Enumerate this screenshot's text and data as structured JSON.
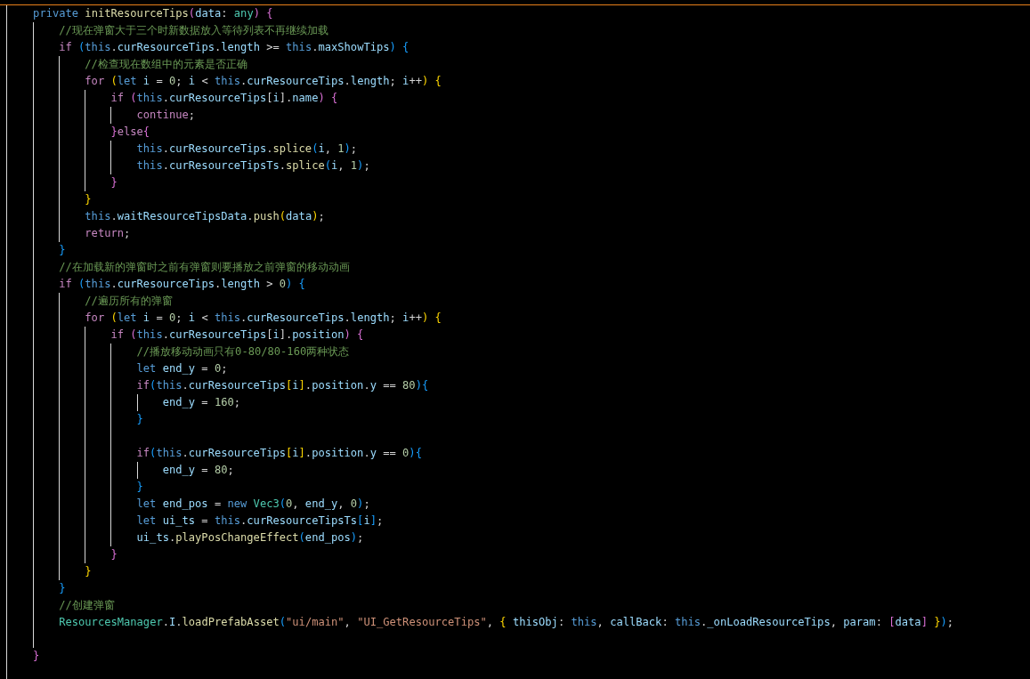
{
  "editor": {
    "lines": [
      {
        "kind": "code",
        "tokens": [
          {
            "kind": "kw",
            "text": "    private"
          },
          {
            "kind": "fn",
            "text": " initResourceTips"
          },
          {
            "kind": "b2",
            "text": "("
          },
          {
            "kind": "var",
            "text": "data"
          },
          {
            "kind": "pun",
            "text": ": "
          },
          {
            "kind": "type",
            "text": "any"
          },
          {
            "kind": "b2",
            "text": ")"
          },
          {
            "kind": "b2",
            "text": " {"
          }
        ]
      },
      {
        "kind": "code",
        "tokens": [
          {
            "kind": "cmt",
            "text": "        //现在弹窗大于三个时新数据放入等待列表不再继续加载"
          }
        ]
      },
      {
        "kind": "code",
        "tokens": [
          {
            "kind": "ctl",
            "text": "        if"
          },
          {
            "kind": "b3",
            "text": " ("
          },
          {
            "kind": "kw",
            "text": "this"
          },
          {
            "kind": "pun",
            "text": "."
          },
          {
            "kind": "var",
            "text": "curResourceTips"
          },
          {
            "kind": "pun",
            "text": "."
          },
          {
            "kind": "var",
            "text": "length"
          },
          {
            "kind": "pun",
            "text": " >= "
          },
          {
            "kind": "kw",
            "text": "this"
          },
          {
            "kind": "pun",
            "text": "."
          },
          {
            "kind": "var",
            "text": "maxShowTips"
          },
          {
            "kind": "b3",
            "text": ")"
          },
          {
            "kind": "b3",
            "text": " {"
          }
        ]
      },
      {
        "kind": "code",
        "tokens": [
          {
            "kind": "cmt",
            "text": "            //检查现在数组中的元素是否正确"
          }
        ]
      },
      {
        "kind": "code",
        "tokens": [
          {
            "kind": "ctl",
            "text": "            for"
          },
          {
            "kind": "b1",
            "text": " ("
          },
          {
            "kind": "kw",
            "text": "let"
          },
          {
            "kind": "var",
            "text": " i"
          },
          {
            "kind": "pun",
            "text": " = "
          },
          {
            "kind": "num",
            "text": "0"
          },
          {
            "kind": "pun",
            "text": "; "
          },
          {
            "kind": "var",
            "text": "i"
          },
          {
            "kind": "pun",
            "text": " < "
          },
          {
            "kind": "kw",
            "text": "this"
          },
          {
            "kind": "pun",
            "text": "."
          },
          {
            "kind": "var",
            "text": "curResourceTips"
          },
          {
            "kind": "pun",
            "text": "."
          },
          {
            "kind": "var",
            "text": "length"
          },
          {
            "kind": "pun",
            "text": "; "
          },
          {
            "kind": "var",
            "text": "i"
          },
          {
            "kind": "pun",
            "text": "++"
          },
          {
            "kind": "b1",
            "text": ")"
          },
          {
            "kind": "b1",
            "text": " {"
          }
        ]
      },
      {
        "kind": "code",
        "tokens": [
          {
            "kind": "ctl",
            "text": "                if"
          },
          {
            "kind": "b2",
            "text": " ("
          },
          {
            "kind": "kw",
            "text": "this"
          },
          {
            "kind": "pun",
            "text": "."
          },
          {
            "kind": "var",
            "text": "curResourceTips"
          },
          {
            "kind": "pun",
            "text": "["
          },
          {
            "kind": "var",
            "text": "i"
          },
          {
            "kind": "pun",
            "text": "]."
          },
          {
            "kind": "var",
            "text": "name"
          },
          {
            "kind": "b2",
            "text": ")"
          },
          {
            "kind": "b2",
            "text": " {"
          }
        ]
      },
      {
        "kind": "code",
        "tokens": [
          {
            "kind": "ctl",
            "text": "                    continue"
          },
          {
            "kind": "pun",
            "text": ";"
          }
        ]
      },
      {
        "kind": "code",
        "tokens": [
          {
            "kind": "b2",
            "text": "                }"
          },
          {
            "kind": "ctl",
            "text": "else"
          },
          {
            "kind": "b2",
            "text": "{"
          }
        ]
      },
      {
        "kind": "code",
        "tokens": [
          {
            "kind": "kw",
            "text": "                    this"
          },
          {
            "kind": "pun",
            "text": "."
          },
          {
            "kind": "var",
            "text": "curResourceTips"
          },
          {
            "kind": "pun",
            "text": "."
          },
          {
            "kind": "fn",
            "text": "splice"
          },
          {
            "kind": "b3",
            "text": "("
          },
          {
            "kind": "var",
            "text": "i"
          },
          {
            "kind": "pun",
            "text": ", "
          },
          {
            "kind": "num",
            "text": "1"
          },
          {
            "kind": "b3",
            "text": ")"
          },
          {
            "kind": "pun",
            "text": ";"
          }
        ]
      },
      {
        "kind": "code",
        "tokens": [
          {
            "kind": "kw",
            "text": "                    this"
          },
          {
            "kind": "pun",
            "text": "."
          },
          {
            "kind": "var",
            "text": "curResourceTipsTs"
          },
          {
            "kind": "pun",
            "text": "."
          },
          {
            "kind": "fn",
            "text": "splice"
          },
          {
            "kind": "b3",
            "text": "("
          },
          {
            "kind": "var",
            "text": "i"
          },
          {
            "kind": "pun",
            "text": ", "
          },
          {
            "kind": "num",
            "text": "1"
          },
          {
            "kind": "b3",
            "text": ")"
          },
          {
            "kind": "pun",
            "text": ";"
          }
        ]
      },
      {
        "kind": "code",
        "tokens": [
          {
            "kind": "b2",
            "text": "                }"
          }
        ]
      },
      {
        "kind": "code",
        "tokens": [
          {
            "kind": "b1",
            "text": "            }"
          }
        ]
      },
      {
        "kind": "code",
        "tokens": [
          {
            "kind": "kw",
            "text": "            this"
          },
          {
            "kind": "pun",
            "text": "."
          },
          {
            "kind": "var",
            "text": "waitResourceTipsData"
          },
          {
            "kind": "pun",
            "text": "."
          },
          {
            "kind": "fn",
            "text": "push"
          },
          {
            "kind": "b1",
            "text": "("
          },
          {
            "kind": "var",
            "text": "data"
          },
          {
            "kind": "b1",
            "text": ")"
          },
          {
            "kind": "pun",
            "text": ";"
          }
        ]
      },
      {
        "kind": "code",
        "tokens": [
          {
            "kind": "ctl",
            "text": "            return"
          },
          {
            "kind": "pun",
            "text": ";"
          }
        ]
      },
      {
        "kind": "code",
        "tokens": [
          {
            "kind": "b3",
            "text": "        }"
          }
        ]
      },
      {
        "kind": "code",
        "tokens": [
          {
            "kind": "cmt",
            "text": "        //在加载新的弹窗时之前有弹窗则要播放之前弹窗的移动动画"
          }
        ]
      },
      {
        "kind": "code",
        "tokens": [
          {
            "kind": "ctl",
            "text": "        if"
          },
          {
            "kind": "b3",
            "text": " ("
          },
          {
            "kind": "kw",
            "text": "this"
          },
          {
            "kind": "pun",
            "text": "."
          },
          {
            "kind": "var",
            "text": "curResourceTips"
          },
          {
            "kind": "pun",
            "text": "."
          },
          {
            "kind": "var",
            "text": "length"
          },
          {
            "kind": "pun",
            "text": " > "
          },
          {
            "kind": "num",
            "text": "0"
          },
          {
            "kind": "b3",
            "text": ")"
          },
          {
            "kind": "b3",
            "text": " {"
          }
        ]
      },
      {
        "kind": "code",
        "tokens": [
          {
            "kind": "cmt",
            "text": "            //遍历所有的弹窗"
          }
        ]
      },
      {
        "kind": "code",
        "tokens": [
          {
            "kind": "ctl",
            "text": "            for"
          },
          {
            "kind": "b1",
            "text": " ("
          },
          {
            "kind": "kw",
            "text": "let"
          },
          {
            "kind": "var",
            "text": " i"
          },
          {
            "kind": "pun",
            "text": " = "
          },
          {
            "kind": "num",
            "text": "0"
          },
          {
            "kind": "pun",
            "text": "; "
          },
          {
            "kind": "var",
            "text": "i"
          },
          {
            "kind": "pun",
            "text": " < "
          },
          {
            "kind": "kw",
            "text": "this"
          },
          {
            "kind": "pun",
            "text": "."
          },
          {
            "kind": "var",
            "text": "curResourceTips"
          },
          {
            "kind": "pun",
            "text": "."
          },
          {
            "kind": "var",
            "text": "length"
          },
          {
            "kind": "pun",
            "text": "; "
          },
          {
            "kind": "var",
            "text": "i"
          },
          {
            "kind": "pun",
            "text": "++"
          },
          {
            "kind": "b1",
            "text": ")"
          },
          {
            "kind": "b1",
            "text": " {"
          }
        ]
      },
      {
        "kind": "code",
        "tokens": [
          {
            "kind": "ctl",
            "text": "                if"
          },
          {
            "kind": "b2",
            "text": " ("
          },
          {
            "kind": "kw",
            "text": "this"
          },
          {
            "kind": "pun",
            "text": "."
          },
          {
            "kind": "var",
            "text": "curResourceTips"
          },
          {
            "kind": "pun",
            "text": "["
          },
          {
            "kind": "var",
            "text": "i"
          },
          {
            "kind": "pun",
            "text": "]."
          },
          {
            "kind": "var",
            "text": "position"
          },
          {
            "kind": "b2",
            "text": ")"
          },
          {
            "kind": "b2",
            "text": " {"
          }
        ]
      },
      {
        "kind": "code",
        "tokens": [
          {
            "kind": "cmt",
            "text": "                    //播放移动动画只有0-80/80-160两种状态"
          }
        ]
      },
      {
        "kind": "code",
        "tokens": [
          {
            "kind": "kw",
            "text": "                    let"
          },
          {
            "kind": "var",
            "text": " end_y"
          },
          {
            "kind": "pun",
            "text": " = "
          },
          {
            "kind": "num",
            "text": "0"
          },
          {
            "kind": "pun",
            "text": ";"
          }
        ]
      },
      {
        "kind": "code",
        "tokens": [
          {
            "kind": "ctl",
            "text": "                    if"
          },
          {
            "kind": "b3",
            "text": "("
          },
          {
            "kind": "kw",
            "text": "this"
          },
          {
            "kind": "pun",
            "text": "."
          },
          {
            "kind": "var",
            "text": "curResourceTips"
          },
          {
            "kind": "b1",
            "text": "["
          },
          {
            "kind": "var",
            "text": "i"
          },
          {
            "kind": "b1",
            "text": "]"
          },
          {
            "kind": "pun",
            "text": "."
          },
          {
            "kind": "var",
            "text": "position"
          },
          {
            "kind": "pun",
            "text": "."
          },
          {
            "kind": "var",
            "text": "y"
          },
          {
            "kind": "pun",
            "text": " == "
          },
          {
            "kind": "num",
            "text": "80"
          },
          {
            "kind": "b3",
            "text": ")"
          },
          {
            "kind": "b3",
            "text": "{"
          }
        ]
      },
      {
        "kind": "code",
        "tokens": [
          {
            "kind": "var",
            "text": "                        end_y"
          },
          {
            "kind": "pun",
            "text": " = "
          },
          {
            "kind": "num",
            "text": "160"
          },
          {
            "kind": "pun",
            "text": ";"
          }
        ]
      },
      {
        "kind": "code",
        "tokens": [
          {
            "kind": "b3",
            "text": "                    }"
          }
        ]
      },
      {
        "kind": "blank"
      },
      {
        "kind": "code",
        "tokens": [
          {
            "kind": "ctl",
            "text": "                    if"
          },
          {
            "kind": "b3",
            "text": "("
          },
          {
            "kind": "kw",
            "text": "this"
          },
          {
            "kind": "pun",
            "text": "."
          },
          {
            "kind": "var",
            "text": "curResourceTips"
          },
          {
            "kind": "b1",
            "text": "["
          },
          {
            "kind": "var",
            "text": "i"
          },
          {
            "kind": "b1",
            "text": "]"
          },
          {
            "kind": "pun",
            "text": "."
          },
          {
            "kind": "var",
            "text": "position"
          },
          {
            "kind": "pun",
            "text": "."
          },
          {
            "kind": "var",
            "text": "y"
          },
          {
            "kind": "pun",
            "text": " == "
          },
          {
            "kind": "num",
            "text": "0"
          },
          {
            "kind": "b3",
            "text": ")"
          },
          {
            "kind": "b3",
            "text": "{"
          }
        ]
      },
      {
        "kind": "code",
        "tokens": [
          {
            "kind": "var",
            "text": "                        end_y"
          },
          {
            "kind": "pun",
            "text": " = "
          },
          {
            "kind": "num",
            "text": "80"
          },
          {
            "kind": "pun",
            "text": ";"
          }
        ]
      },
      {
        "kind": "code",
        "tokens": [
          {
            "kind": "b3",
            "text": "                    }"
          }
        ]
      },
      {
        "kind": "code",
        "tokens": [
          {
            "kind": "kw",
            "text": "                    let"
          },
          {
            "kind": "var",
            "text": " end_pos"
          },
          {
            "kind": "pun",
            "text": " = "
          },
          {
            "kind": "kw",
            "text": "new"
          },
          {
            "kind": "type",
            "text": " Vec3"
          },
          {
            "kind": "b3",
            "text": "("
          },
          {
            "kind": "num",
            "text": "0"
          },
          {
            "kind": "pun",
            "text": ", "
          },
          {
            "kind": "var",
            "text": "end_y"
          },
          {
            "kind": "pun",
            "text": ", "
          },
          {
            "kind": "num",
            "text": "0"
          },
          {
            "kind": "b3",
            "text": ")"
          },
          {
            "kind": "pun",
            "text": ";"
          }
        ]
      },
      {
        "kind": "code",
        "tokens": [
          {
            "kind": "kw",
            "text": "                    let"
          },
          {
            "kind": "var",
            "text": " ui_ts"
          },
          {
            "kind": "pun",
            "text": " = "
          },
          {
            "kind": "kw",
            "text": "this"
          },
          {
            "kind": "pun",
            "text": "."
          },
          {
            "kind": "var",
            "text": "curResourceTipsTs"
          },
          {
            "kind": "b3",
            "text": "["
          },
          {
            "kind": "var",
            "text": "i"
          },
          {
            "kind": "b3",
            "text": "]"
          },
          {
            "kind": "pun",
            "text": ";"
          }
        ]
      },
      {
        "kind": "code",
        "tokens": [
          {
            "kind": "var",
            "text": "                    ui_ts"
          },
          {
            "kind": "pun",
            "text": "."
          },
          {
            "kind": "fn",
            "text": "playPosChangeEffect"
          },
          {
            "kind": "b3",
            "text": "("
          },
          {
            "kind": "var",
            "text": "end_pos"
          },
          {
            "kind": "b3",
            "text": ")"
          },
          {
            "kind": "pun",
            "text": ";"
          }
        ]
      },
      {
        "kind": "code",
        "tokens": [
          {
            "kind": "b2",
            "text": "                }"
          }
        ]
      },
      {
        "kind": "code",
        "tokens": [
          {
            "kind": "b1",
            "text": "            }"
          }
        ]
      },
      {
        "kind": "code",
        "tokens": [
          {
            "kind": "b3",
            "text": "        }"
          }
        ]
      },
      {
        "kind": "code",
        "tokens": [
          {
            "kind": "cmt",
            "text": "        //创建弹窗"
          }
        ]
      },
      {
        "kind": "code",
        "tokens": [
          {
            "kind": "type",
            "text": "        ResourcesManager"
          },
          {
            "kind": "pun",
            "text": "."
          },
          {
            "kind": "var",
            "text": "I"
          },
          {
            "kind": "pun",
            "text": "."
          },
          {
            "kind": "fn",
            "text": "loadPrefabAsset"
          },
          {
            "kind": "b3",
            "text": "("
          },
          {
            "kind": "str",
            "text": "\"ui/main\""
          },
          {
            "kind": "pun",
            "text": ", "
          },
          {
            "kind": "str",
            "text": "\"UI_GetResourceTips\""
          },
          {
            "kind": "pun",
            "text": ", "
          },
          {
            "kind": "b1",
            "text": "{"
          },
          {
            "kind": "var",
            "text": " thisObj"
          },
          {
            "kind": "pun",
            "text": ": "
          },
          {
            "kind": "kw",
            "text": "this"
          },
          {
            "kind": "pun",
            "text": ", "
          },
          {
            "kind": "var",
            "text": "callBack"
          },
          {
            "kind": "pun",
            "text": ": "
          },
          {
            "kind": "kw",
            "text": "this"
          },
          {
            "kind": "pun",
            "text": "."
          },
          {
            "kind": "var",
            "text": "_onLoadResourceTips"
          },
          {
            "kind": "pun",
            "text": ", "
          },
          {
            "kind": "var",
            "text": "param"
          },
          {
            "kind": "pun",
            "text": ": "
          },
          {
            "kind": "b2",
            "text": "["
          },
          {
            "kind": "var",
            "text": "data"
          },
          {
            "kind": "b2",
            "text": "]"
          },
          {
            "kind": "b1",
            "text": " }"
          },
          {
            "kind": "b3",
            "text": ")"
          },
          {
            "kind": "pun",
            "text": ";"
          }
        ]
      },
      {
        "kind": "blank"
      },
      {
        "kind": "code",
        "tokens": [
          {
            "kind": "b2",
            "text": "    }"
          }
        ]
      }
    ]
  }
}
